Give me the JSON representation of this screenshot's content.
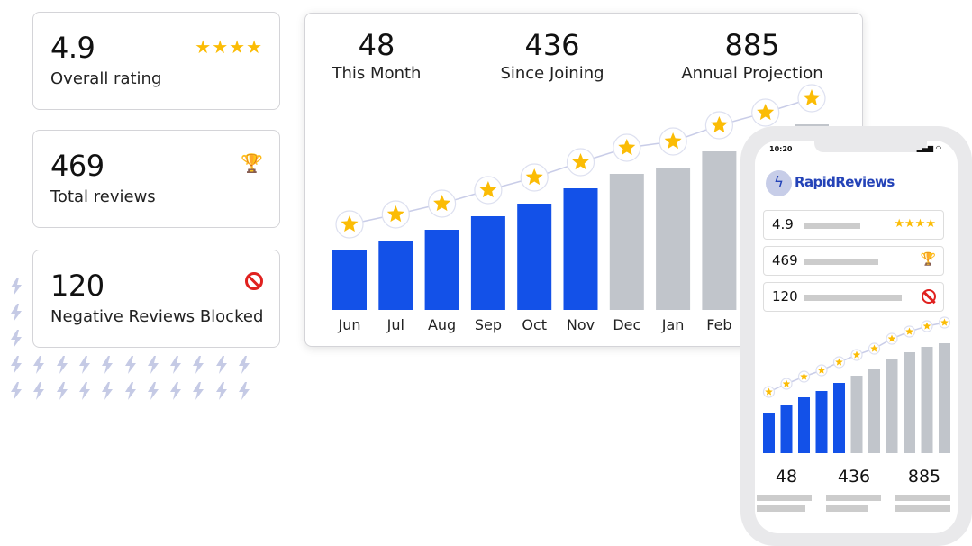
{
  "kpis": [
    {
      "value": "4.9",
      "label": "Overall rating",
      "icon": "four-stars",
      "stars": "★★★★"
    },
    {
      "value": "469",
      "label": "Total reviews",
      "icon": "trophy-icon",
      "glyph": "🏆"
    },
    {
      "value": "120",
      "label": "Negative Reviews Blocked",
      "icon": "prohibited-icon"
    }
  ],
  "stats": [
    {
      "value": "48",
      "label": "This Month"
    },
    {
      "value": "436",
      "label": "Since Joining"
    },
    {
      "value": "885",
      "label": "Annual Projection"
    }
  ],
  "chart_data": {
    "type": "bar",
    "categories": [
      "Jun",
      "Jul",
      "Aug",
      "Sep",
      "Oct",
      "Nov",
      "Dec",
      "Jan",
      "Feb"
    ],
    "values": [
      66,
      77,
      89,
      104,
      118,
      135,
      151,
      158,
      176,
      190,
      206
    ],
    "actual_count": 6,
    "colors": {
      "actual": "#1351e8",
      "projected": "#c1c5cb",
      "star": "#fbbc05",
      "line": "#c9cde8"
    }
  },
  "phone": {
    "time": "10:20",
    "brand": "RapidReviews",
    "brand_color": "#2443b8",
    "rows": [
      {
        "value": "4.9",
        "stars": "★★★★"
      },
      {
        "value": "469",
        "glyph": "🏆"
      },
      {
        "value": "120"
      }
    ],
    "chart_values": [
      45,
      54,
      62,
      69,
      78,
      86,
      93,
      104,
      112,
      118,
      122
    ],
    "actual_count": 5,
    "stats": [
      "48",
      "436",
      "885"
    ]
  }
}
